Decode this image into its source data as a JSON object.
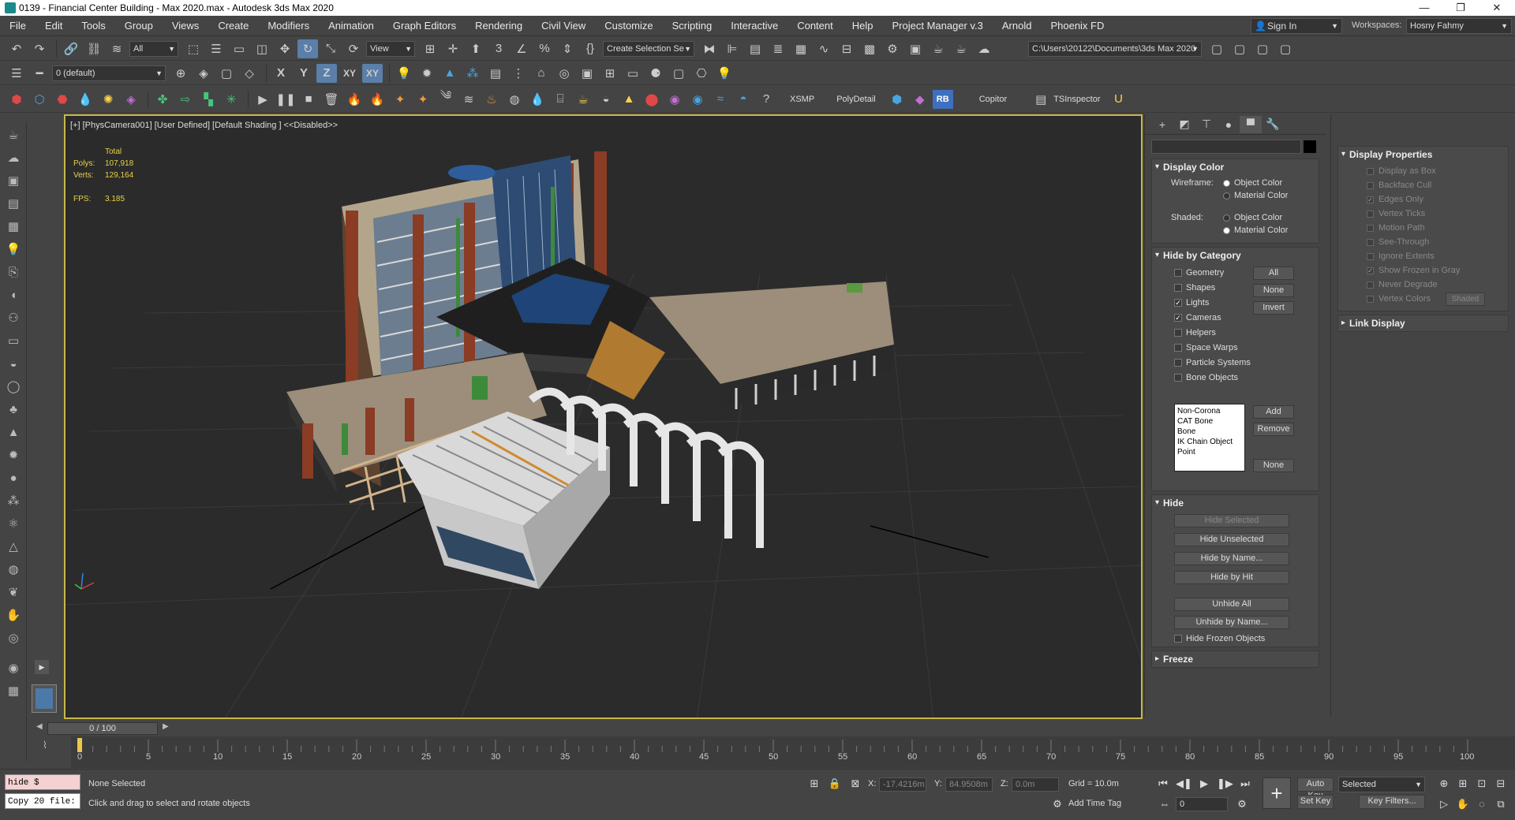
{
  "window": {
    "title": "0139 - Financial Center Building - Max 2020.max - Autodesk 3ds Max 2020",
    "minimize": "—",
    "maximize": "❐",
    "close": "✕"
  },
  "menu": [
    "File",
    "Edit",
    "Tools",
    "Group",
    "Views",
    "Create",
    "Modifiers",
    "Animation",
    "Graph Editors",
    "Rendering",
    "Civil View",
    "Customize",
    "Scripting",
    "Interactive",
    "Content",
    "Help",
    "Project Manager v.3",
    "Arnold",
    "Phoenix FD"
  ],
  "signin": {
    "label": "Sign In"
  },
  "workspace": {
    "label": "Workspaces:",
    "value": "Hosny Fahmy"
  },
  "toolbar1": {
    "selection_filter": "All",
    "ref_coord": "View",
    "named_selection": "Create Selection Se",
    "project_path": "C:\\Users\\20122\\Documents\\3ds Max 2020"
  },
  "toolbar2": {
    "layer": "0 (default)",
    "axis_x": "X",
    "axis_y": "Y",
    "axis_z": "Z",
    "axis_xy": "XY",
    "axis_xy2": "XY"
  },
  "toolbar3": {
    "xsmp": "XSMP",
    "polydetail": "PolyDetail",
    "rb": "RB",
    "copitor": "Copitor",
    "tsinspector": "TSInspector"
  },
  "viewport": {
    "label": "[+] [PhysCamera001] [User Defined] [Default Shading ] <<Disabled>>",
    "stats": {
      "total_label": "Total",
      "polys_label": "Polys:",
      "polys": "107,918",
      "verts_label": "Verts:",
      "verts": "129,164",
      "fps_label": "FPS:",
      "fps": "3.185"
    }
  },
  "display_panel": {
    "display_color": {
      "title": "Display Color",
      "wireframe_label": "Wireframe:",
      "shaded_label": "Shaded:",
      "object_color": "Object Color",
      "material_color": "Material Color"
    },
    "hide_by_category": {
      "title": "Hide by Category",
      "items": [
        {
          "label": "Geometry",
          "checked": false
        },
        {
          "label": "Shapes",
          "checked": false
        },
        {
          "label": "Lights",
          "checked": true
        },
        {
          "label": "Cameras",
          "checked": true
        },
        {
          "label": "Helpers",
          "checked": false
        },
        {
          "label": "Space Warps",
          "checked": false
        },
        {
          "label": "Particle Systems",
          "checked": false
        },
        {
          "label": "Bone Objects",
          "checked": false
        }
      ],
      "btn_all": "All",
      "btn_none": "None",
      "btn_invert": "Invert",
      "list": [
        "Non-Corona",
        "CAT Bone",
        "Bone",
        "IK Chain Object",
        "Point"
      ],
      "btn_add": "Add",
      "btn_remove": "Remove",
      "btn_none2": "None"
    },
    "hide": {
      "title": "Hide",
      "hide_selected": "Hide Selected",
      "hide_unselected": "Hide Unselected",
      "hide_by_name": "Hide by Name...",
      "hide_by_hit": "Hide by Hit",
      "unhide_all": "Unhide All",
      "unhide_by_name": "Unhide by Name...",
      "hide_frozen": "Hide Frozen Objects"
    },
    "freeze": {
      "title": "Freeze"
    }
  },
  "display_properties": {
    "title": "Display Properties",
    "items": [
      {
        "label": "Display as Box",
        "checked": false
      },
      {
        "label": "Backface Cull",
        "checked": false
      },
      {
        "label": "Edges Only",
        "checked": true
      },
      {
        "label": "Vertex Ticks",
        "checked": false
      },
      {
        "label": "Motion Path",
        "checked": false
      },
      {
        "label": "See-Through",
        "checked": false
      },
      {
        "label": "Ignore Extents",
        "checked": false
      },
      {
        "label": "Show Frozen in Gray",
        "checked": true
      },
      {
        "label": "Never Degrade",
        "checked": false
      },
      {
        "label": "Vertex Colors",
        "checked": false
      }
    ],
    "shaded_btn": "Shaded",
    "link_display": "Link Display"
  },
  "timeline": {
    "slider": "0 / 100",
    "ticks": [
      "0",
      "5",
      "10",
      "15",
      "20",
      "25",
      "30",
      "35",
      "40",
      "45",
      "50",
      "55",
      "60",
      "65",
      "70",
      "75",
      "80",
      "85",
      "90",
      "95",
      "100"
    ]
  },
  "status": {
    "maxscript_1": "hide $",
    "maxscript_2": "Copy 20 file:",
    "selection": "None Selected",
    "prompt": "Click and drag to select and rotate objects",
    "x_label": "X:",
    "x": "-17.4216m",
    "y_label": "Y:",
    "y": "84.9508m",
    "z_label": "Z:",
    "z": "0.0m",
    "grid": "Grid = 10.0m",
    "add_time_tag": "Add Time Tag",
    "auto_key": "Auto Key",
    "set_key": "Set Key",
    "key_mode": "Selected",
    "key_filters": "Key Filters...",
    "frame": "0"
  }
}
